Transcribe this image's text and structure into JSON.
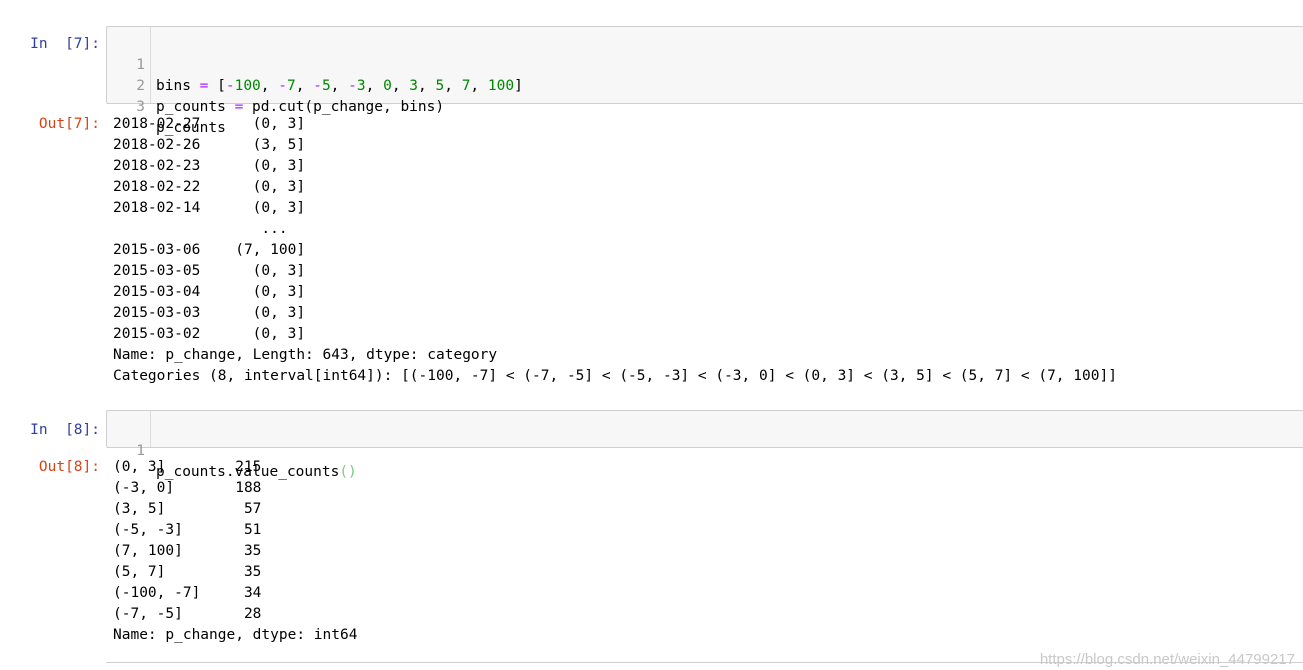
{
  "cells": [
    {
      "in_prompt": "In  [7]:",
      "out_prompt": "Out[7]:",
      "code_lines": [
        {
          "no": "1",
          "text": "bins = [-100, -7, -5, -3, 0, 3, 5, 7, 100]"
        },
        {
          "no": "2",
          "text": "p_counts = pd.cut(p_change, bins)"
        },
        {
          "no": "3",
          "text": "p_counts"
        }
      ],
      "output_lines": [
        "2018-02-27      (0, 3]",
        "2018-02-26      (3, 5]",
        "2018-02-23      (0, 3]",
        "2018-02-22      (0, 3]",
        "2018-02-14      (0, 3]",
        "                 ...",
        "2015-03-06    (7, 100]",
        "2015-03-05      (0, 3]",
        "2015-03-04      (0, 3]",
        "2015-03-03      (0, 3]",
        "2015-03-02      (0, 3]",
        "Name: p_change, Length: 643, dtype: category",
        "Categories (8, interval[int64]): [(-100, -7] < (-7, -5] < (-5, -3] < (-3, 0] < (0, 3] < (3, 5] < (5, 7] < (7, 100]]"
      ]
    },
    {
      "in_prompt": "In  [8]:",
      "out_prompt": "Out[8]:",
      "code_lines": [
        {
          "no": "1",
          "text": "p_counts.value_counts()"
        }
      ],
      "output_lines": [
        "(0, 3]        215",
        "(-3, 0]       188",
        "(3, 5]         57",
        "(-5, -3]       51",
        "(7, 100]       35",
        "(5, 7]         35",
        "(-100, -7]     34",
        "(-7, -5]       28",
        "Name: p_change, dtype: int64"
      ]
    }
  ],
  "watermark": "https://blog.csdn.net/weixin_44799217",
  "colors": {
    "in_prompt": "#303F9F",
    "out_prompt": "#D84315",
    "operator": "#AA22FF",
    "number": "#008800",
    "input_bg": "#f7f7f7"
  }
}
